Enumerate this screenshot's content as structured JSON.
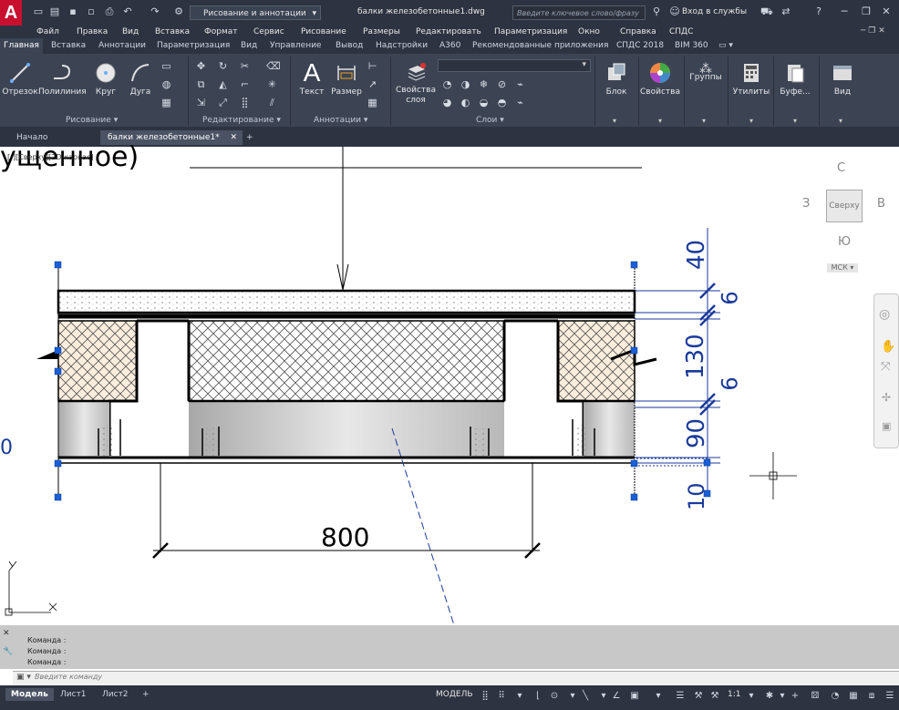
{
  "titlebar": {
    "workspace": "Рисование и аннотации",
    "doc_title": "балки железобетонные1.dwg",
    "search_placeholder": "Введите ключевое слово/фразу",
    "login": "Вход в службы"
  },
  "menu": [
    "Файл",
    "Правка",
    "Вид",
    "Вставка",
    "Формат",
    "Сервис",
    "Рисование",
    "Размеры",
    "Редактировать",
    "Параметризация",
    "Окно",
    "Справка",
    "СПДС"
  ],
  "ribbon_tabs": {
    "items": [
      "Главная",
      "Вставка",
      "Аннотации",
      "Параметризация",
      "Вид",
      "Управление",
      "Вывод",
      "Надстройки",
      "A360",
      "Рекомендованные приложения",
      "СПДС 2018",
      "BIM 360"
    ],
    "active": "Главная"
  },
  "ribbon": {
    "draw": [
      "Отрезок",
      "Полилиния",
      "Круг",
      "Дуга"
    ],
    "panels": [
      "Рисование",
      "Редактирование",
      "Аннотации",
      "Слои"
    ],
    "annot": [
      "Текст",
      "Размер"
    ],
    "layer_props": "Свойства слоя",
    "right": [
      "Блок",
      "Свойства",
      "Группы",
      "Утилиты",
      "Буфе...",
      "Вид"
    ]
  },
  "doc_tabs": [
    "Начало",
    "балки железобетонные1*"
  ],
  "canvas": {
    "view_label": "[-][Сверху][2D-каркас]",
    "partial_text": "ущенное)",
    "dim_bottom": "800",
    "dims_right": [
      "40",
      "6",
      "130",
      "6",
      "90",
      "10"
    ],
    "left_partial": "0",
    "viewcube": {
      "n": "С",
      "w": "З",
      "e": "В",
      "s": "Ю",
      "top": "Сверху"
    },
    "ucs": "МСК"
  },
  "command": {
    "history": [
      "Команда :",
      "Команда :",
      "Команда :"
    ],
    "prompt": "Введите команду"
  },
  "layouts": [
    "Модель",
    "Лист1",
    "Лист2"
  ],
  "status": {
    "model": "МОДЕЛЬ",
    "scale": "1:1"
  }
}
